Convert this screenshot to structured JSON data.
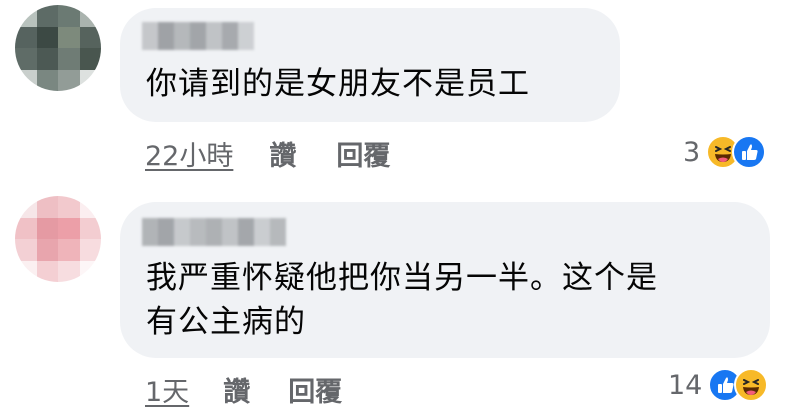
{
  "comments": [
    {
      "body": "你请到的是女朋友不是员工",
      "time": "22小時",
      "like_label": "讚",
      "reply_label": "回覆",
      "reaction_count": "3",
      "reactions": [
        "haha-icon",
        "like-icon"
      ]
    },
    {
      "body_line1": "我严重怀疑他把你当另一半。这个是",
      "body_line2": "有公主病的",
      "time": "1天",
      "like_label": "讚",
      "reply_label": "回覆",
      "reaction_count": "14",
      "reactions": [
        "like-icon",
        "haha-icon"
      ]
    }
  ],
  "colors": {
    "bubble": "#f0f2f5",
    "meta_text": "#65676b",
    "like_blue": "#1877f2",
    "haha_yellow": "#f7b928"
  }
}
